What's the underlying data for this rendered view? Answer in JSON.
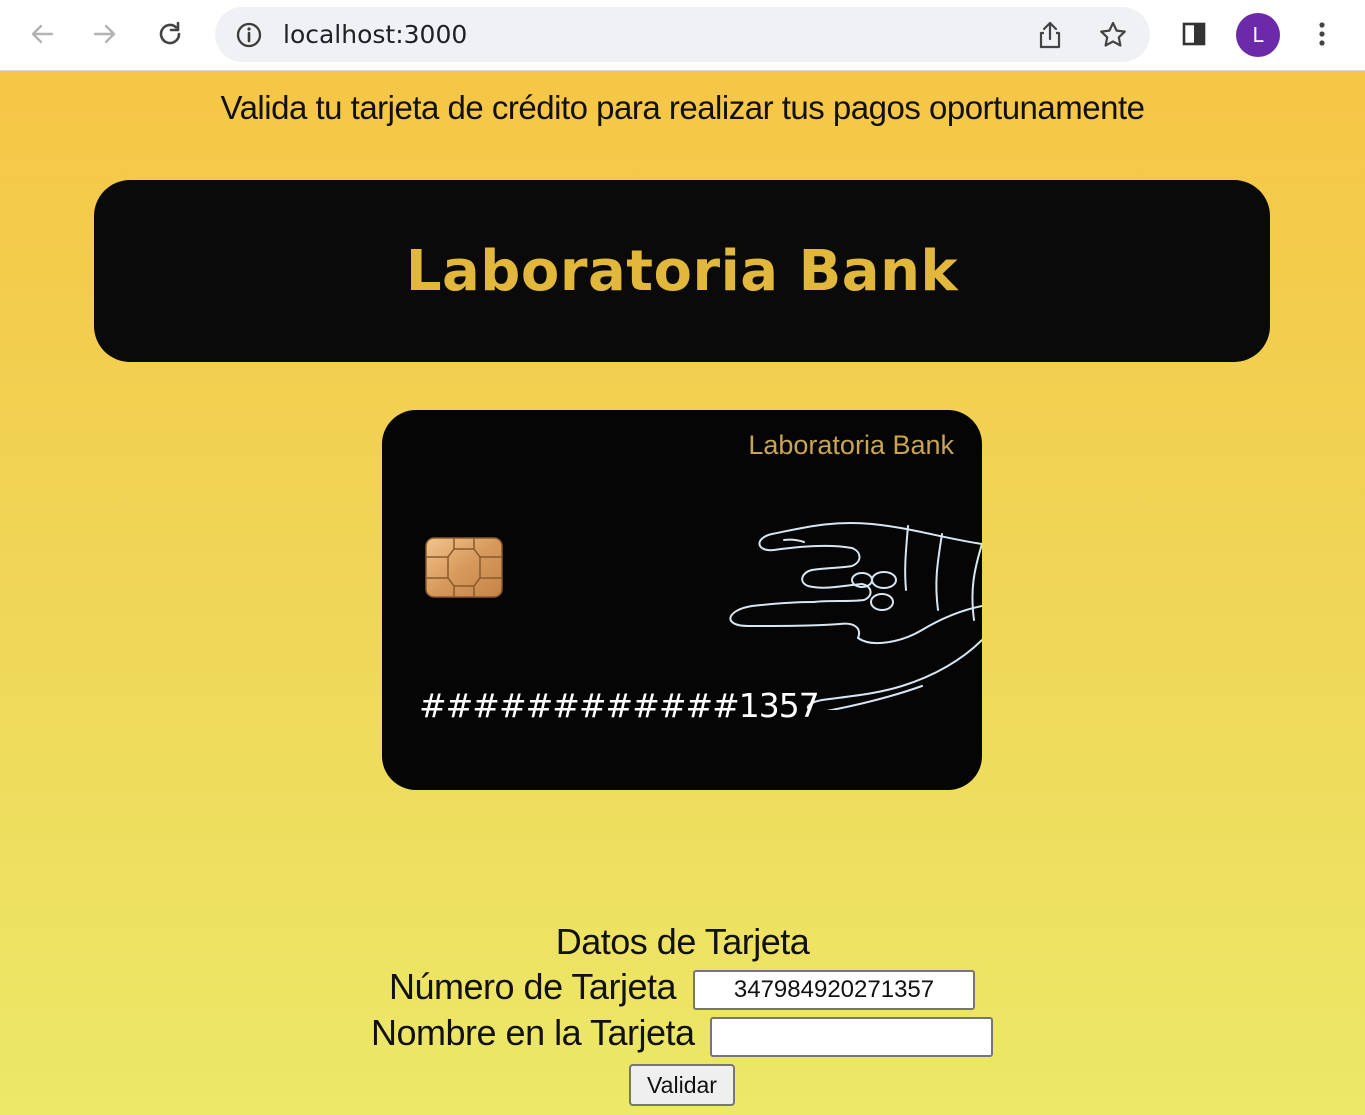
{
  "browser": {
    "url": "localhost:3000",
    "profile_initial": "L",
    "profile_color": "#6d2aa8"
  },
  "page": {
    "tagline": "Valida tu tarjeta de crédito para realizar tus pagos oportunamente",
    "header_title": "Laboratoria Bank",
    "colors": {
      "background_top": "#f6c646",
      "background_bottom": "#ece868",
      "header_bg": "#0a0a0a",
      "header_text": "#e2b83c",
      "card_bg": "#050505",
      "card_bank_text": "#c9a451"
    }
  },
  "card": {
    "bank_name": "Laboratoria Bank",
    "masked_number": "############1357",
    "icons": [
      "chip-icon",
      "hand-rock-icon"
    ]
  },
  "form": {
    "title": "Datos de Tarjeta",
    "number_label": "Número de Tarjeta",
    "number_value": "347984920271357",
    "name_label": "Nombre en la Tarjeta",
    "name_value": "",
    "submit_label": "Validar"
  }
}
